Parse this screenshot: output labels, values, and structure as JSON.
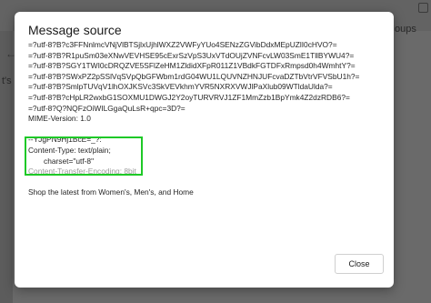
{
  "background": {
    "groups_label": "oups",
    "its_label": "t's (",
    "back_arrow_icon": "arrow-left-icon"
  },
  "dialog": {
    "title": "Message source",
    "close_label": "Close",
    "source_lines": [
      "=?utf-8?B?c3FFNnlmcVNjVlBTSjlxUjhlWXZ2VWFyYUo4SENzZGVibDdxMEpUZlI0cHVO?=",
      "=?utf-8?B?R1puSm03eXNwVEVHSE95cExrSzVpS3UxVTdOUjZVNFcvLW03SmE1TllBYWU4?=",
      "=?utf-8?B?SGY1TWI0cDRQZVE5SFlZeHM1ZldidXFpR011Z1VBdkFGTDFxRmpsd0h4WmhtY?=",
      "=?utf-8?B?SWxPZ2pSSlVqSVpQbGFWbm1rdG04WU1LQUVNZHNJUFcvaDZTbVtrVFVSbU1h?=",
      "=?utf-8?B?SmlpTUVqV1lhOXJKSVc3SkVEVkhmYVR5NXRXVWJlPaXlub09WTldaUlda?=",
      "=?utf-8?B?cHpLR2wxbG1SOXMU1DWGJ2Y2oyTURVRVJ1ZF1MmZzb1BpYmk4Z2dzRDB6?=",
      "=?utf-8?Q?NQFzOiWILGgaQuLsR+qpc=3D?="
    ],
    "mime_version": "MIME-Version: 1.0",
    "boundary": "--YJgPN9Hj1BcE=_?:",
    "content_type": "Content-Type: text/plain;",
    "charset": "charset=\"utf-8\"",
    "transfer_encoding": "Content-Transfer-Encoding: 8bit",
    "body_text": "Shop the latest from Women's, Men's, and Home"
  },
  "colors": {
    "highlight": "#1ec927",
    "overlay": "#6a6a6a"
  }
}
